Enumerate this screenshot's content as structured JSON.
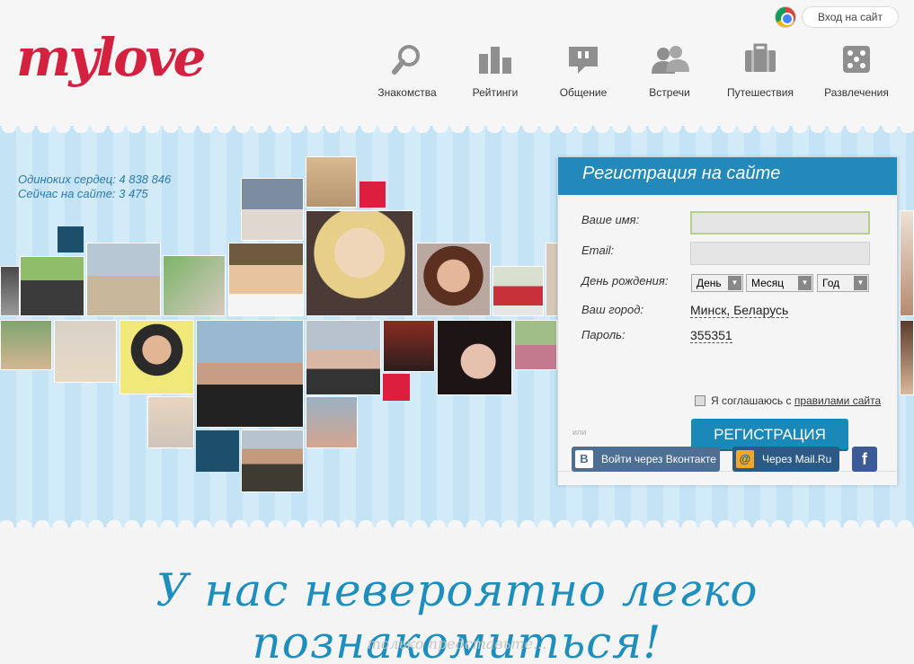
{
  "header": {
    "logo_text": "mylove",
    "login_label": "Вход на сайт",
    "nav": [
      {
        "label": "Знакомства",
        "icon": "search-icon"
      },
      {
        "label": "Рейтинги",
        "icon": "bar-chart-icon"
      },
      {
        "label": "Общение",
        "icon": "speech-bubble-icon"
      },
      {
        "label": "Встречи",
        "icon": "people-icon"
      },
      {
        "label": "Путешествия",
        "icon": "suitcase-icon"
      },
      {
        "label": "Развлечения",
        "icon": "dice-icon"
      }
    ]
  },
  "stats": {
    "singles": "Одиноких сердец: 4 838 846",
    "online": "Сейчас на сайте: 3 475"
  },
  "registration": {
    "title": "Регистрация на сайте",
    "name_label": "Ваше имя:",
    "email_label": "Email:",
    "birthday_label": "День рождения:",
    "day": "День",
    "month": "Месяц",
    "year": "Год",
    "city_label": "Ваш город:",
    "city_value": "Минск, Беларусь",
    "password_label": "Пароль:",
    "password_value": "355351",
    "agree_text": "Я соглашаюсь с",
    "agree_link": "правилами сайта",
    "submit": "РЕГИСТРАЦИЯ",
    "or": "или",
    "vk_label": "Войти через Вконтакте",
    "mailru_label": "Через Mail.Ru"
  },
  "tagline": "У нас невероятно легко познакомиться!",
  "subline": "только представьте...",
  "colors": {
    "brand": "#d4213f",
    "accent": "#2289ba",
    "dark_square": "#1c4f6a",
    "red_square": "#dc1f3f"
  }
}
